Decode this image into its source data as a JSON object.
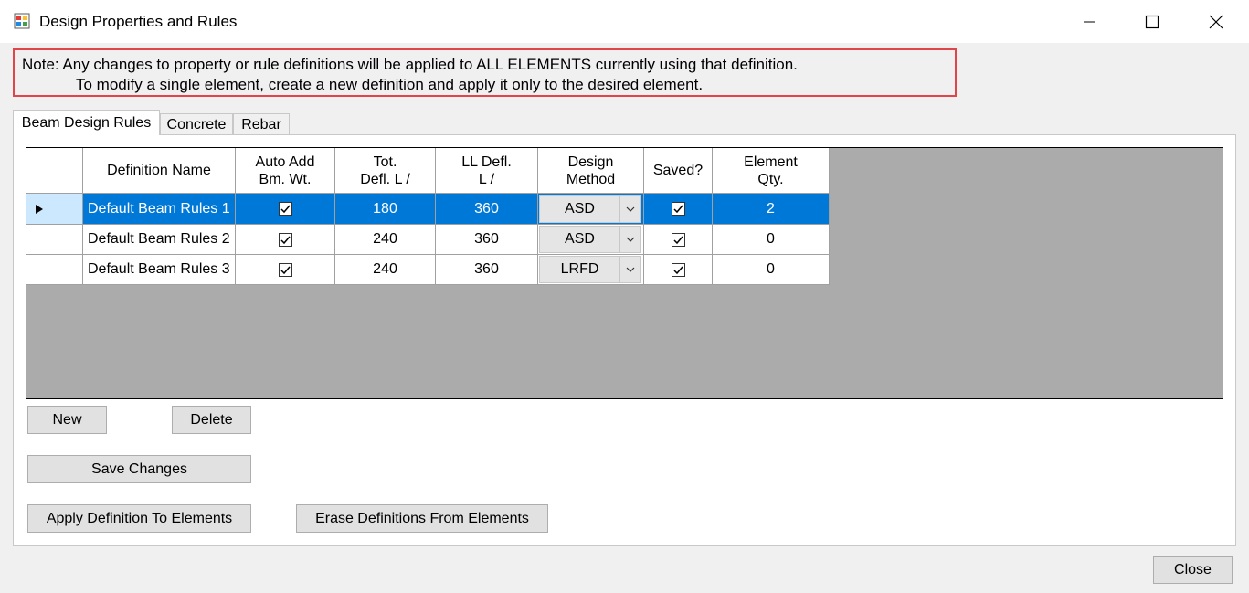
{
  "window": {
    "title": "Design Properties and Rules",
    "icon": "app-window-icon"
  },
  "note": {
    "line1": "Note:  Any changes to property or rule definitions will be applied to ALL ELEMENTS currently using that definition.",
    "line2": "To modify a single element, create a new definition and apply it only to the desired element."
  },
  "tabs": [
    {
      "label": "Beam Design Rules",
      "active": true
    },
    {
      "label": "Concrete",
      "active": false
    },
    {
      "label": "Rebar",
      "active": false
    }
  ],
  "grid": {
    "columns": [
      {
        "line1": "Definition Name",
        "line2": ""
      },
      {
        "line1": "Auto Add",
        "line2": "Bm. Wt."
      },
      {
        "line1": "Tot.",
        "line2": "Defl. L /"
      },
      {
        "line1": "LL Defl.",
        "line2": "L /"
      },
      {
        "line1": "Design",
        "line2": "Method"
      },
      {
        "line1": "Saved?",
        "line2": ""
      },
      {
        "line1": "Element",
        "line2": "Qty."
      }
    ],
    "rows": [
      {
        "name": "Default Beam Rules 1",
        "auto_add": true,
        "tot_defl": "180",
        "ll_defl": "360",
        "method": "ASD",
        "saved": true,
        "qty": "2",
        "selected": true
      },
      {
        "name": "Default Beam Rules 2",
        "auto_add": true,
        "tot_defl": "240",
        "ll_defl": "360",
        "method": "ASD",
        "saved": true,
        "qty": "0",
        "selected": false
      },
      {
        "name": "Default Beam Rules 3",
        "auto_add": true,
        "tot_defl": "240",
        "ll_defl": "360",
        "method": "LRFD",
        "saved": true,
        "qty": "0",
        "selected": false
      }
    ]
  },
  "buttons": {
    "new": "New",
    "delete": "Delete",
    "save_changes": "Save Changes",
    "apply_definition": "Apply Definition To Elements",
    "erase_definitions": "Erase Definitions From Elements",
    "close": "Close"
  },
  "colors": {
    "selection": "#0078d7",
    "note_border": "#e0454a",
    "grid_background": "#ababab"
  }
}
